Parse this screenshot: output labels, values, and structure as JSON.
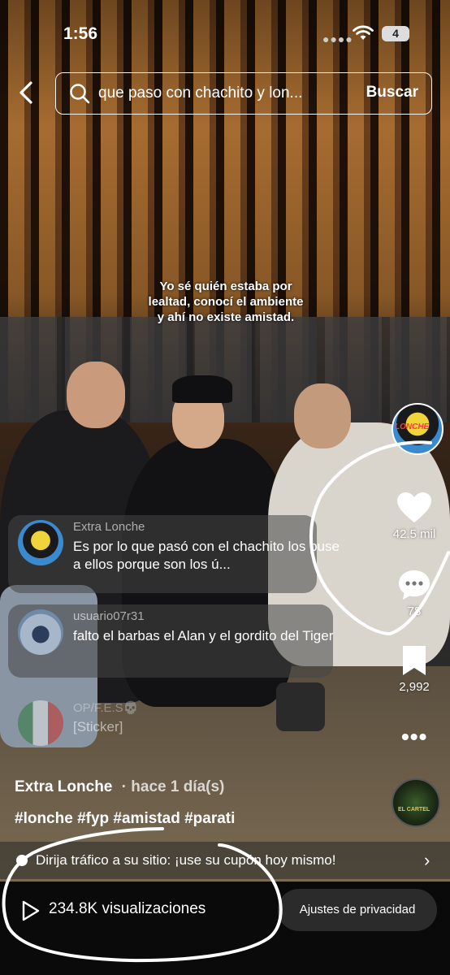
{
  "status_bar": {
    "time": "1:56",
    "battery": "4"
  },
  "search": {
    "query": "que paso con chachito y lon...",
    "button_label": "Buscar"
  },
  "video": {
    "overlay_caption": "Yo sé quién estaba por lealtad, conocí el ambiente y ahí no existe amistad."
  },
  "actions": {
    "creator_avatar_text": "LONCHE",
    "likes": "42.5 mil",
    "comments": "78",
    "saves": "2,992",
    "music_disc_text": "EL CARTEL"
  },
  "comments": [
    {
      "user": "Extra Lonche",
      "text": "Es por lo que pasó con el chachito los puse a ellos porque son los ú..."
    },
    {
      "user": "usuario07r31",
      "text": "falto el barbas el Alan y el gordito del Tiger"
    },
    {
      "user": "OP/F.E.S💀",
      "text": "[Sticker]"
    }
  ],
  "post": {
    "author": "Extra Lonche",
    "separator": "·",
    "time_ago": "hace 1 día(s)",
    "hashtags": "#lonche #fyp #amistad #parati"
  },
  "promo": {
    "text": "Dirija tráfico a su sitio: ¡use su cupón hoy mismo!"
  },
  "footer": {
    "views": "234.8K visualizaciones",
    "privacy_button": "Ajustes de privacidad"
  }
}
